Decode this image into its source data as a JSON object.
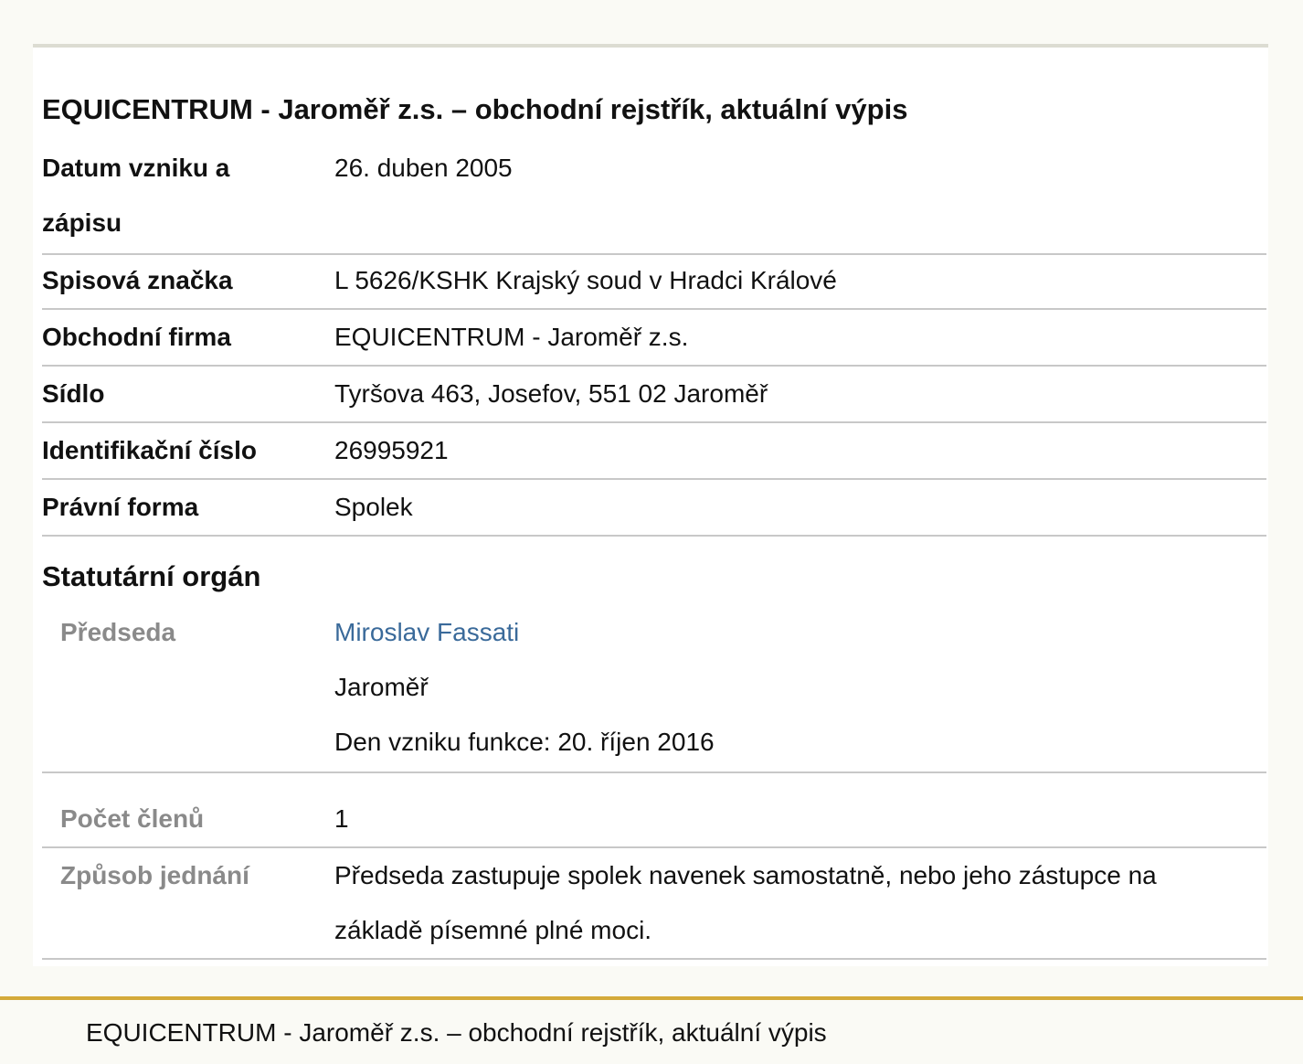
{
  "page_title": "EQUICENTRUM - Jaroměř z.s. – obchodní rejstřík, aktuální výpis",
  "rows": [
    {
      "label": "Datum vzniku a zápisu",
      "value": "26. duben 2005"
    },
    {
      "label": "Spisová značka",
      "value": "L 5626/KSHK Krajský soud v Hradci Králové"
    },
    {
      "label": "Obchodní firma",
      "value": "EQUICENTRUM - Jaroměř z.s."
    },
    {
      "label": "Sídlo",
      "value": "Tyršova 463, Josefov, 551 02 Jaroměř"
    },
    {
      "label": "Identifikační číslo",
      "value": "26995921"
    },
    {
      "label": "Právní forma",
      "value": "Spolek"
    }
  ],
  "statutory": {
    "section_title": "Statutární orgán",
    "chair": {
      "label": "Předseda",
      "name": "Miroslav Fassati",
      "city": "Jaroměř",
      "since": "Den vzniku funkce: 20. říjen 2016"
    },
    "member_count": {
      "label": "Počet členů",
      "value": "1"
    },
    "representation": {
      "label": "Způsob jednání",
      "value": "Předseda zastupuje spolek navenek samostatně, nebo jeho zástupce na základě písemné plné moci."
    }
  },
  "footer": {
    "text": "EQUICENTRUM - Jaroměř z.s. – obchodní rejstřík, aktuální výpis",
    "accent_color": "#d4aa3a"
  },
  "colors": {
    "link": "#3a6a9a",
    "muted_label": "#8a8a8a"
  }
}
